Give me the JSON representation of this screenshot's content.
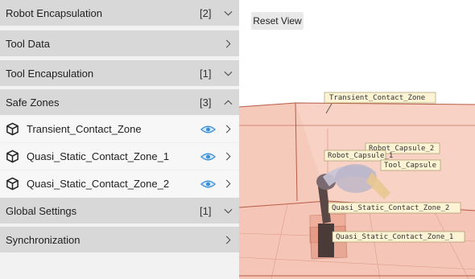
{
  "panel": {
    "sections": [
      {
        "label": "Robot Encapsulation",
        "count": "[2]",
        "chevron": "chevron-down"
      },
      {
        "label": "Tool Data",
        "count": "",
        "chevron": "chevron-right"
      },
      {
        "label": "Tool Encapsulation",
        "count": "[1]",
        "chevron": "chevron-down"
      },
      {
        "label": "Safe Zones",
        "count": "[3]",
        "chevron": "chevron-up"
      },
      {
        "label": "Global Settings",
        "count": "[1]",
        "chevron": "chevron-down"
      },
      {
        "label": "Synchronization",
        "count": "",
        "chevron": "chevron-right"
      }
    ],
    "safe_zones": [
      {
        "label": "Transient_Contact_Zone",
        "icon": "cube-icon",
        "visibility_icon": "eye-icon"
      },
      {
        "label": "Quasi_Static_Contact_Zone_1",
        "icon": "cube-icon",
        "visibility_icon": "eye-icon"
      },
      {
        "label": "Quasi_Static_Contact_Zone_2",
        "icon": "cube-icon",
        "visibility_icon": "eye-icon"
      }
    ]
  },
  "viewport": {
    "reset_label": "Reset View",
    "labels": {
      "transient": "Transient_Contact_Zone",
      "robot_capsule_2": "Robot_Capsule_2",
      "robot_capsule_1": "Robot_Capsule_1",
      "tool_capsule": "Tool_Capsule",
      "quasi_2": "Quasi_Static_Contact_Zone_2",
      "quasi_1": "Quasi_Static_Contact_Zone_1"
    }
  },
  "colors": {
    "header_bg": "#d8d8d8",
    "item_bg": "#f7f7f7",
    "eye_accent": "#3b8fd9",
    "zone_fill": "#f2b9a6",
    "zone_stroke": "#b85a45",
    "label_bg": "#fbf3d3"
  }
}
